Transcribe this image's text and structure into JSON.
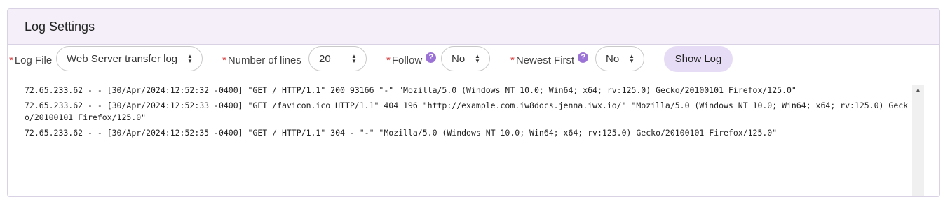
{
  "panel": {
    "title": "Log Settings"
  },
  "controls": {
    "log_file": {
      "label": "Log File",
      "value": "Web Server transfer log"
    },
    "lines": {
      "label": "Number of lines",
      "value": "20"
    },
    "follow": {
      "label": "Follow",
      "value": "No",
      "help": "?"
    },
    "newest_first": {
      "label": "Newest First",
      "value": "No",
      "help": "?"
    },
    "required_mark": "*",
    "show_log_label": "Show Log"
  },
  "log_lines": [
    "72.65.233.62 - - [30/Apr/2024:12:52:32 -0400] \"GET / HTTP/1.1\" 200 93166 \"-\" \"Mozilla/5.0 (Windows NT 10.0; Win64; x64; rv:125.0) Gecko/20100101 Firefox/125.0\"",
    "72.65.233.62 - - [30/Apr/2024:12:52:33 -0400] \"GET /favicon.ico HTTP/1.1\" 404 196 \"http://example.com.iw8docs.jenna.iwx.io/\" \"Mozilla/5.0 (Windows NT 10.0; Win64; x64; rv:125.0) Gecko/20100101 Firefox/125.0\"",
    "72.65.233.62 - - [30/Apr/2024:12:52:35 -0400] \"GET / HTTP/1.1\" 304 - \"-\" \"Mozilla/5.0 (Windows NT 10.0; Win64; x64; rv:125.0) Gecko/20100101 Firefox/125.0\""
  ]
}
